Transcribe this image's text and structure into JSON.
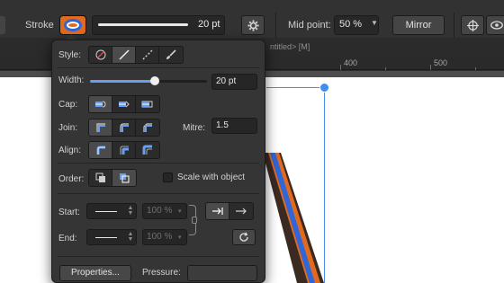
{
  "toolbar": {
    "stroke_label": "Stroke",
    "width_value": "20 pt",
    "gear_icon": "gear-icon",
    "midpoint_label": "Mid point:",
    "midpoint_value": "50 %",
    "mirror_label": "Mirror",
    "colors": {
      "swatch_fill": "#e06a1f",
      "swatch_ring": "#2f66d8"
    }
  },
  "document": {
    "title_fragment": "ntitled> [M]",
    "ruler_labels": [
      "400",
      "500"
    ]
  },
  "panel": {
    "style_label": "Style:",
    "style_options": [
      "none-style-icon",
      "solid-line-icon",
      "dashed-line-icon",
      "brush-icon"
    ],
    "width_label": "Width:",
    "width_value": "20 pt",
    "width_fraction": 0.55,
    "cap_label": "Cap:",
    "join_label": "Join:",
    "mitre_label": "Mitre:",
    "mitre_value": "1.5",
    "align_label": "Align:",
    "order_label": "Order:",
    "scale_label": "Scale with object",
    "start_label": "Start:",
    "end_label": "End:",
    "start_percent": "100 %",
    "end_percent": "100 %",
    "properties_label": "Properties...",
    "pressure_label": "Pressure:",
    "accent": "#6a9ff0"
  }
}
